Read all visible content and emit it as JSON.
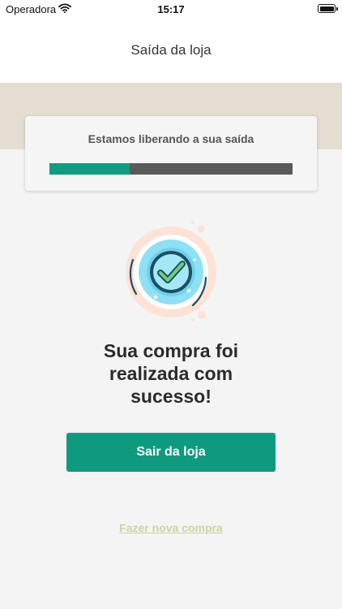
{
  "status_bar": {
    "carrier": "Operadora",
    "time": "15:17",
    "wifi_icon": "wifi-icon",
    "battery_icon": "battery-icon"
  },
  "header": {
    "title": "Saída da loja"
  },
  "progress": {
    "label": "Estamos liberando a sua saída",
    "fraction": 0.33,
    "fill_color": "#159a82",
    "track_color": "#5a5a5a"
  },
  "illustration": {
    "icon": "check-circle-icon",
    "colors": {
      "halo": "#fde2d5",
      "disc": "#8fe0f4",
      "ring": "#1f4e63",
      "check": "#6fcf7f"
    }
  },
  "message": {
    "line1": "Sua compra foi",
    "line2": "realizada com",
    "line3": "sucesso!"
  },
  "actions": {
    "primary_label": "Sair da loja",
    "secondary_label": "Fazer nova compra"
  },
  "colors": {
    "accent": "#0f9a80",
    "band": "#e4ddd1",
    "background": "#f4f4f4",
    "link": "#c8d6a0"
  }
}
